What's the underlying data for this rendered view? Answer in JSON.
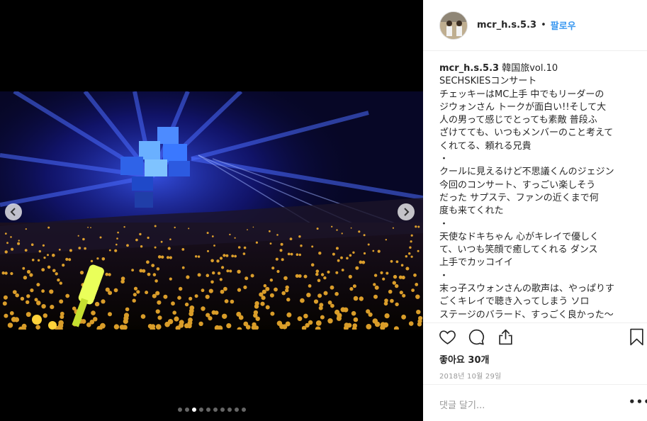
{
  "post": {
    "username": "mcr_h.s.5.3",
    "separator": "•",
    "follow_label": "팔로우",
    "caption_title": "韓国旅vol.10",
    "caption_lines": [
      "SECHSKIESコンサート",
      "チェッキーはMC上手 中でもリーダーの",
      "ジウォンさん トークが面白い!!そして大",
      "人の男って感じでとっても素敵 普段ふ",
      "ざけてても、いつもメンバーのこと考えて",
      "くれてる、頼れる兄貴",
      "・",
      "クールに見えるけど不思議くんのジェジン",
      " 今回のコンサート、すっごい楽しそう",
      "だった サプステ、ファンの近くまで何",
      "度も来てくれた",
      "・",
      "天使なドキちゃん 心がキレイで優しく",
      "て、いつも笑顔で癒してくれる ダンス",
      "上手でカッコイイ",
      "・",
      "末っ子スウォンさんの歌声は、やっぱりす",
      "ごくキレイで聴き入ってしまう ソロ",
      "ステージのバラード、すっごく良かった～"
    ],
    "likes_label": "좋아요 30개",
    "date_label": "2018년 10월 29일",
    "comment_placeholder": "댓글 달기...",
    "more_label": "•••"
  },
  "carousel": {
    "dot_count": 10,
    "active_index": 2
  },
  "icons": {
    "like": "heart-outline-icon",
    "comment": "comment-bubble-icon",
    "share": "share-upload-icon",
    "save": "bookmark-icon",
    "prev": "chevron-left-icon",
    "next": "chevron-right-icon"
  },
  "colors": {
    "follow": "#3897f0",
    "secondary_text": "#999999",
    "stage_blue": "#2a3cff",
    "lightstick_yellow": "#ffd23a"
  }
}
